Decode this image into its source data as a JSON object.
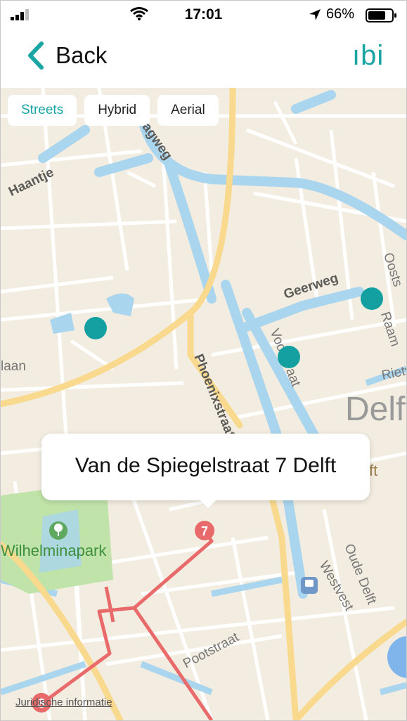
{
  "status_bar": {
    "time": "17:01",
    "battery": "66%"
  },
  "nav": {
    "back_label": "Back",
    "logo_text": "ıbi"
  },
  "map_types": [
    {
      "label": "Streets",
      "active": true
    },
    {
      "label": "Hybrid",
      "active": false
    },
    {
      "label": "Aerial",
      "active": false
    }
  ],
  "map": {
    "labels": {
      "haantje": "Haantje",
      "agweg": "agweg",
      "geerweg": "Geerweg",
      "oosts": "Oosts",
      "raam": "Raam",
      "rietv": "Rietv",
      "voorstraat": "Voorstraat",
      "phoenixstraat": "Phoenixstraat",
      "laan": "laan",
      "city": "Delft",
      "tan_fragment": "ft",
      "park": "Wilhelminapark",
      "oude_delft": "Oude Delft",
      "westvest": "Westvest",
      "pootstraat": "Pootstraat"
    },
    "route_stops": [
      "7",
      "8"
    ],
    "callout_address": "Van de Spiegelstraat 7 Delft",
    "legal_link": "Juridische informatie"
  },
  "colors": {
    "accent": "#1aa5a5",
    "water": "#a9d5ee",
    "land": "#f3ede1",
    "road_major": "#f9d98e",
    "route": "#e86a6a",
    "park": "#bfe3a8"
  }
}
